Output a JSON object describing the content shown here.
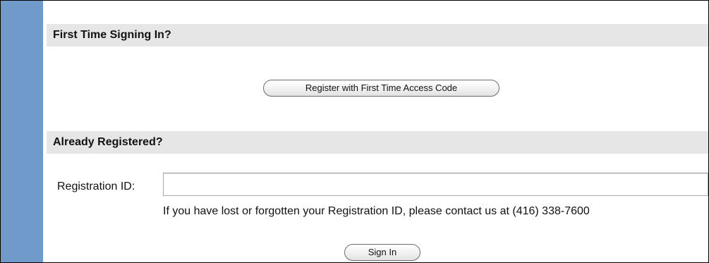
{
  "first_time": {
    "heading": "First Time Signing In?",
    "register_button": "Register with First Time Access Code"
  },
  "already_registered": {
    "heading": "Already Registered?",
    "registration_id_label": "Registration ID:",
    "registration_id_value": "",
    "help_text": "If you have lost or forgotten your Registration ID, please contact us at (416) 338-7600",
    "sign_in_button": "Sign In"
  },
  "colors": {
    "sidebar": "#6f9ac9",
    "header_bg": "#e6e6e6"
  }
}
